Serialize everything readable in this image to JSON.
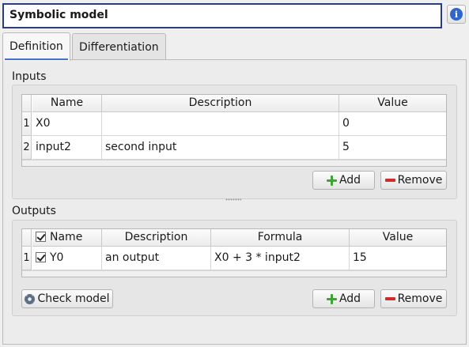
{
  "title_field": {
    "value": "Symbolic model"
  },
  "tabs": [
    {
      "label": "Definition",
      "active": true
    },
    {
      "label": "Differentiation",
      "active": false
    }
  ],
  "inputs": {
    "title": "Inputs",
    "columns": [
      "Name",
      "Description",
      "Value"
    ],
    "rows": [
      {
        "num": "1",
        "name": "X0",
        "description": "",
        "value": "0"
      },
      {
        "num": "2",
        "name": "input2",
        "description": "second input",
        "value": "5"
      }
    ],
    "add_label": "Add",
    "remove_label": "Remove"
  },
  "outputs": {
    "title": "Outputs",
    "columns": [
      "Name",
      "Description",
      "Formula",
      "Value"
    ],
    "rows": [
      {
        "num": "1",
        "checked": true,
        "name": "Y0",
        "description": "an output",
        "formula": "X0 + 3 * input2",
        "value": "15"
      }
    ],
    "check_model_label": "Check model",
    "add_label": "Add",
    "remove_label": "Remove"
  },
  "colors": {
    "accent": "#2a3e7c",
    "add": "#3aa830",
    "remove": "#d12a2a",
    "info": "#2f66c7"
  },
  "icons": [
    "info-icon",
    "plus-icon",
    "minus-icon",
    "gear-icon"
  ]
}
